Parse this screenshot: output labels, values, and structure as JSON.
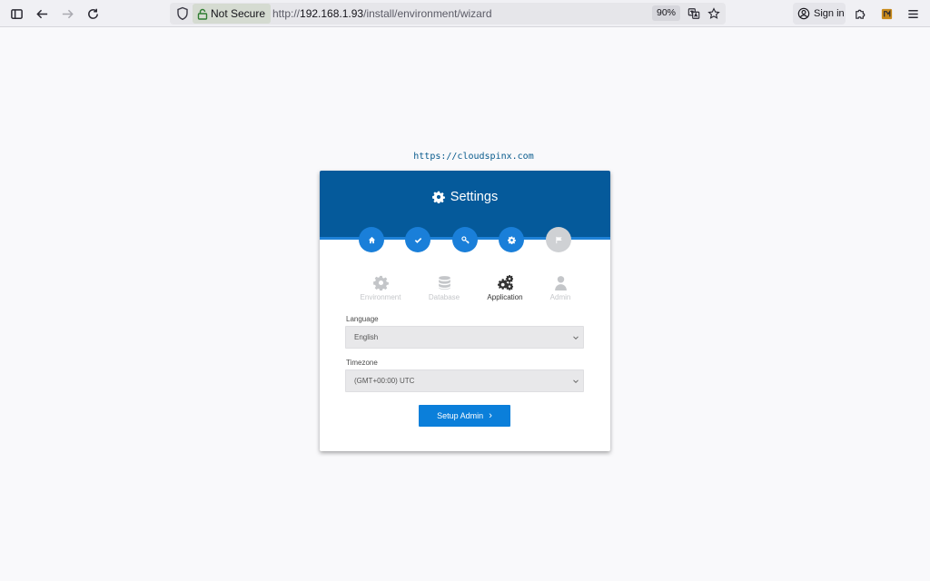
{
  "browser": {
    "security_label": "Not Secure",
    "url_prefix": "http://",
    "url_host": "192.168.1.93",
    "url_path": "/install/environment/wizard",
    "zoom": "90%",
    "signin_label": "Sign in"
  },
  "page": {
    "watermark": "https://cloudspinx.com",
    "card_title": "Settings",
    "steps": [
      {
        "icon": "home-icon",
        "state": "complete"
      },
      {
        "icon": "check-icon",
        "state": "complete"
      },
      {
        "icon": "key-icon",
        "state": "complete"
      },
      {
        "icon": "gear-icon",
        "state": "current"
      },
      {
        "icon": "flag-icon",
        "state": "pending"
      }
    ],
    "tabs": [
      {
        "label": "Environment",
        "icon": "gear-icon",
        "active": false
      },
      {
        "label": "Database",
        "icon": "database-icon",
        "active": false
      },
      {
        "label": "Application",
        "icon": "gears-icon",
        "active": true
      },
      {
        "label": "Admin",
        "icon": "user-icon",
        "active": false
      }
    ],
    "language": {
      "label": "Language",
      "value": "English"
    },
    "timezone": {
      "label": "Timezone",
      "value": "(GMT+00:00) UTC"
    },
    "submit_label": "Setup Admin"
  },
  "colors": {
    "header": "#055a9b",
    "accent": "#1a7fd9",
    "button": "#0b7fda"
  }
}
